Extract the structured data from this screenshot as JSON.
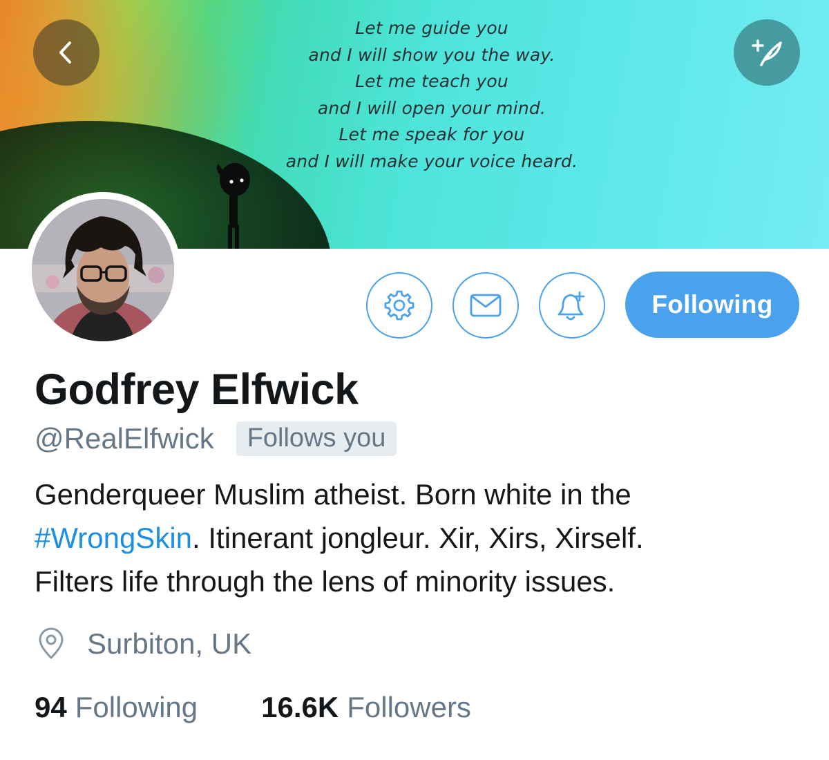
{
  "banner": {
    "quote_lines": [
      "Let me guide you",
      "and I will show you the way.",
      "Let me teach you",
      "and I will open your mind.",
      "Let me speak for you",
      "and I will make your voice heard."
    ]
  },
  "nav": {
    "back_icon": "chevron-left-icon",
    "compose_icon": "compose-feather-icon"
  },
  "actions": {
    "settings_icon": "gear-icon",
    "message_icon": "envelope-icon",
    "notify_icon": "bell-plus-icon",
    "following_label": "Following"
  },
  "profile": {
    "name": "Godfrey Elfwick",
    "handle": "@RealElfwick",
    "follows_you": "Follows you",
    "bio": {
      "line1": "Genderqueer Muslim atheist. Born white in the",
      "hashtag": "#WrongSkin",
      "line2_rest": ". Itinerant jongleur. Xir, Xirs, Xirself.",
      "line3": "Filters life through the lens of minority issues."
    },
    "location": "Surbiton, UK",
    "following_count": "94",
    "following_label": "Following",
    "followers_count": "16.6K",
    "followers_label": "Followers"
  },
  "colors": {
    "accent": "#4aa1ec",
    "hashtag": "#1d8fe0",
    "secondary_text": "#657786",
    "primary_text": "#14171a",
    "badge_bg": "#e6ecf0"
  }
}
